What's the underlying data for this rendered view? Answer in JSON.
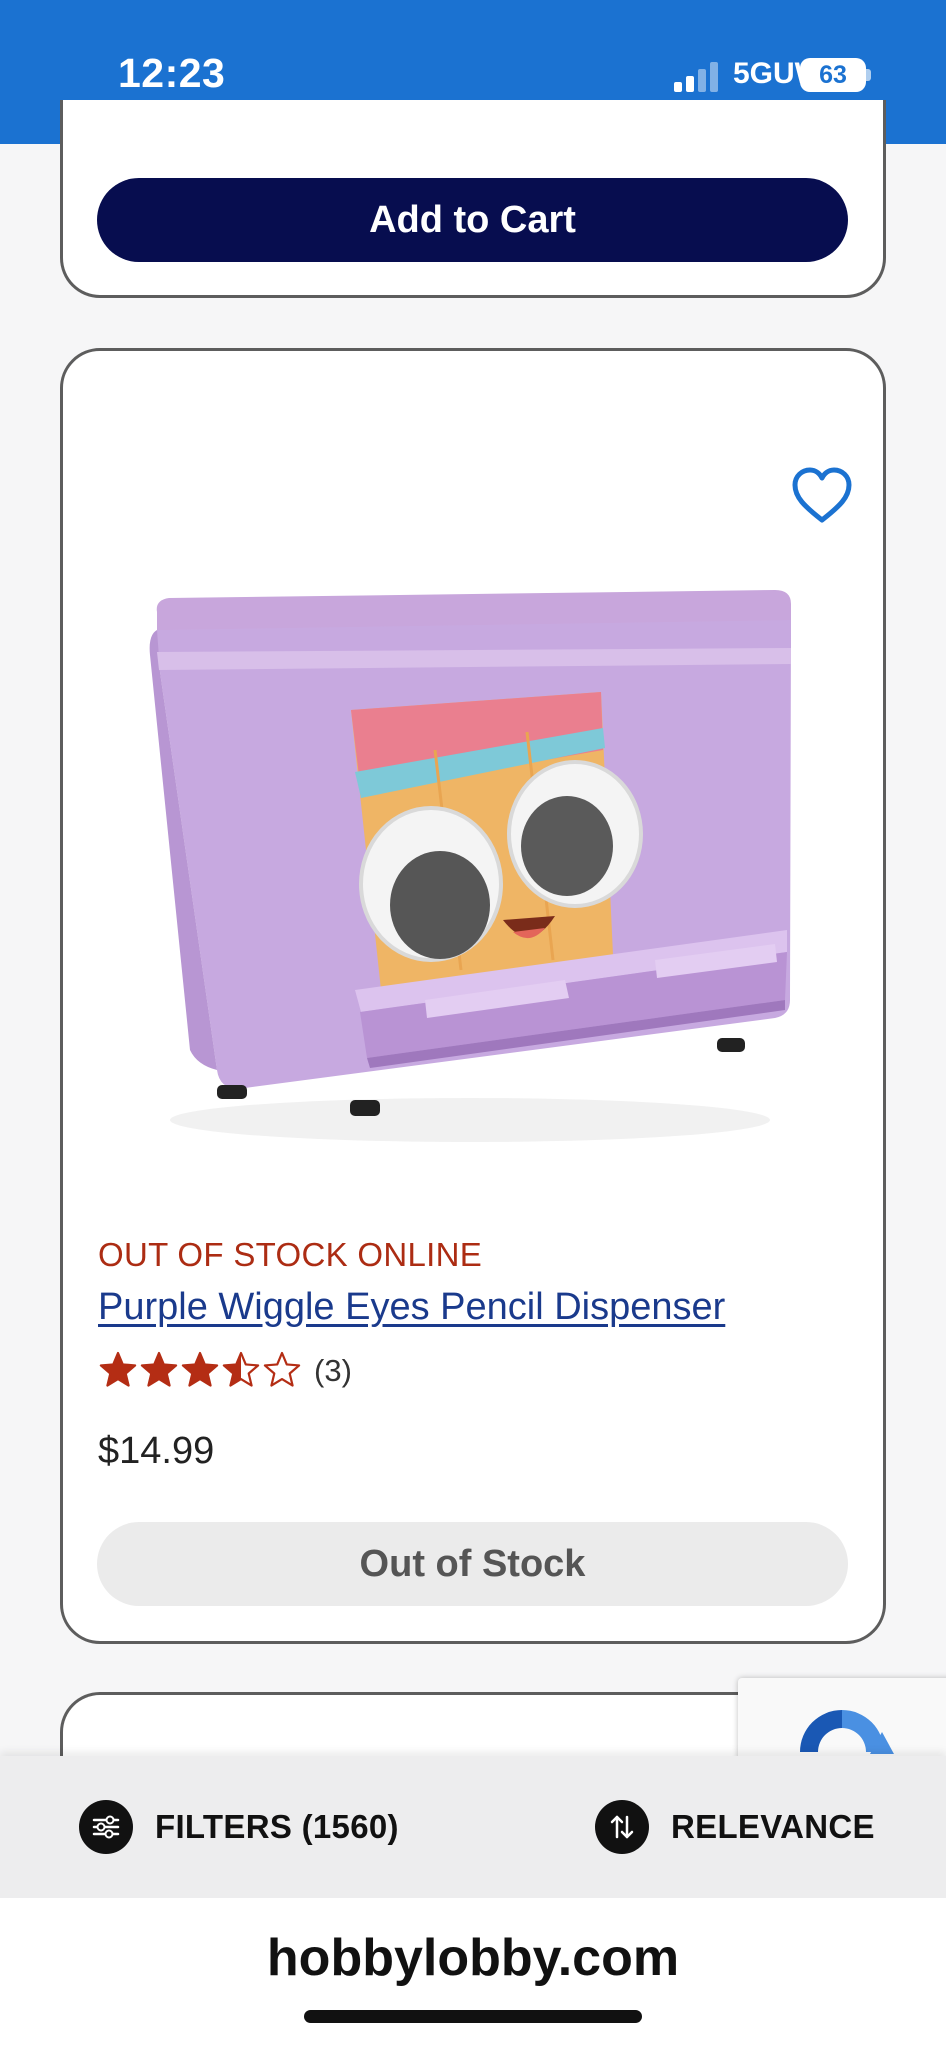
{
  "status_bar": {
    "time": "12:23",
    "network": "5GUW",
    "battery": "63",
    "icons": [
      "signal-icon",
      "battery-icon"
    ]
  },
  "previous_card": {
    "add_to_cart_label": "Add to Cart"
  },
  "product": {
    "stock_status": "OUT OF STOCK ONLINE",
    "title": "Purple Wiggle Eyes Pencil Dispenser",
    "rating_value": 3.5,
    "rating_max": 5,
    "rating_count": "(3)",
    "price": "$14.99",
    "button_label": "Out of Stock",
    "favorite_icon": "heart-outline-icon"
  },
  "filter_bar": {
    "filters_label": "FILTERS (1560)",
    "sort_label": "RELEVANCE",
    "filters_icon": "sliders-icon",
    "sort_icon": "sort-arrows-icon"
  },
  "browser": {
    "url": "hobbylobby.com"
  },
  "colors": {
    "status_bar_bg": "#1b72d1",
    "primary_button": "#070d4f",
    "stock_alert": "#ac2c13",
    "link": "#1a3a8c",
    "star": "#b42d14",
    "heart": "#1b72d1"
  }
}
